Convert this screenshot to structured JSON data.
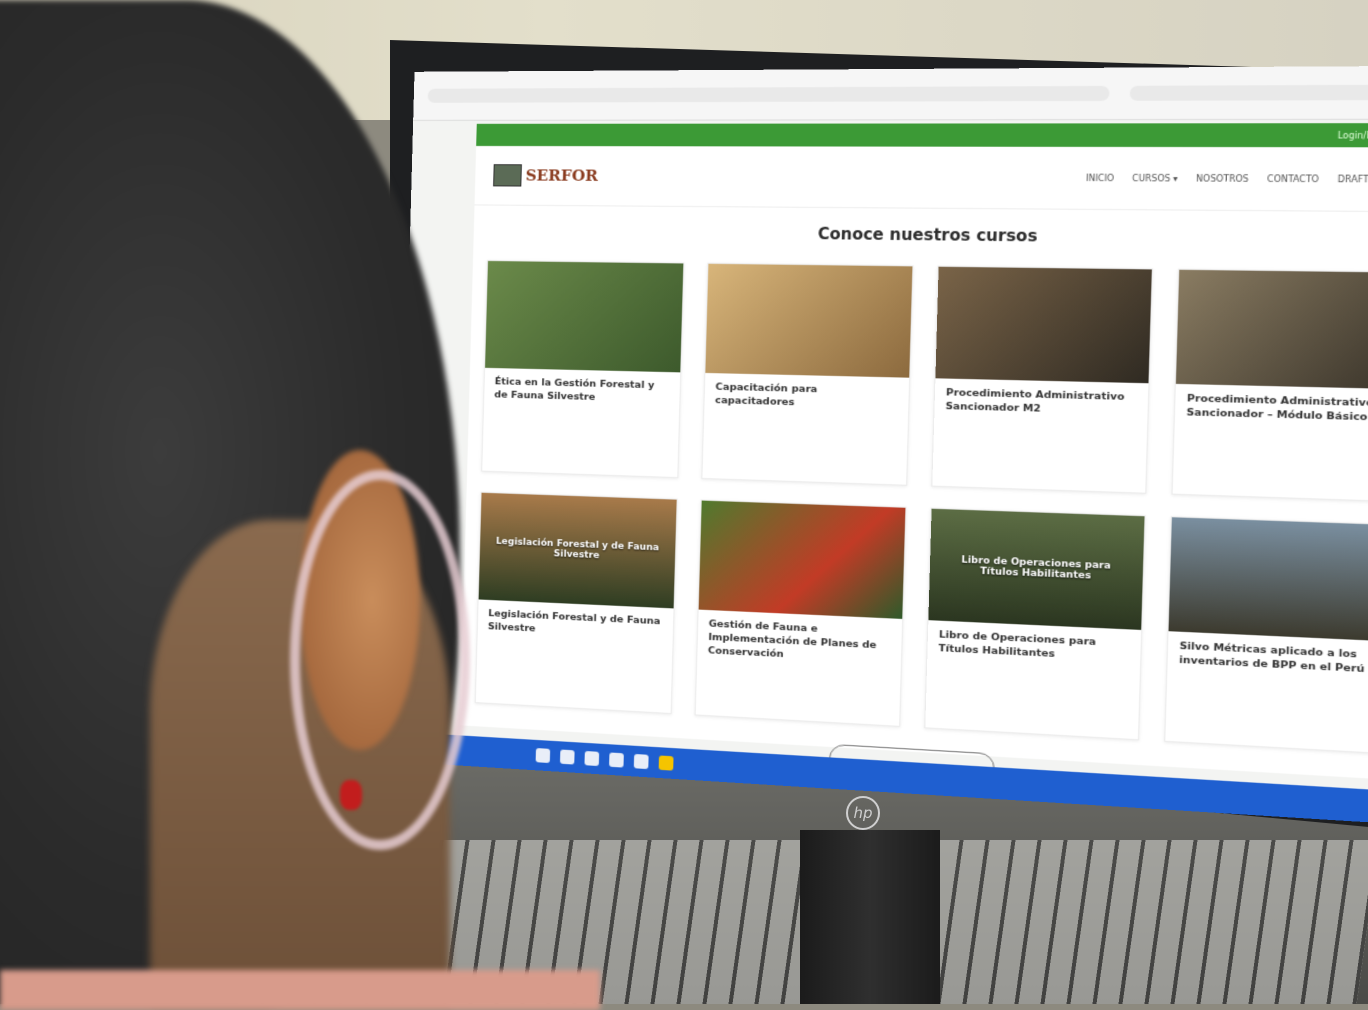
{
  "website": {
    "top_strip_link": "Login/Registro",
    "logo_line1": "SERFOR",
    "logo_line2": "",
    "nav": [
      {
        "label": "INICIO"
      },
      {
        "label": "CURSOS ▾"
      },
      {
        "label": "NOSOTROS"
      },
      {
        "label": "CONTACTO"
      },
      {
        "label": "DRAFT"
      }
    ],
    "section_title": "Conoce nuestros cursos",
    "courses": [
      {
        "title": "Ética en la Gestión Forestal y de Fauna Silvestre",
        "meta": "",
        "thumb_text": "",
        "thumb_color": "#4f6b3c"
      },
      {
        "title": "Capacitación para capacitadores",
        "meta": "",
        "thumb_text": "",
        "thumb_color": "#b98a4a"
      },
      {
        "title": "Procedimiento Administrativo Sancionador M2",
        "meta": "",
        "thumb_text": "",
        "thumb_color": "#5b4b34"
      },
      {
        "title": "Procedimiento Administrativo Sancionador – Módulo Básico",
        "meta": "",
        "thumb_text": "",
        "thumb_color": "#6d6048"
      },
      {
        "title": "Legislación Forestal y de Fauna Silvestre",
        "meta": "",
        "thumb_text": "Legislación Forestal y de Fauna Silvestre",
        "thumb_color": "#3f4f2f"
      },
      {
        "title": "Gestión de Fauna e Implementación de Planes de Conservación",
        "meta": "",
        "thumb_text": "",
        "thumb_color": "#5d7d3a"
      },
      {
        "title": "Libro de Operaciones para Títulos Habilitantes",
        "meta": "",
        "thumb_text": "Libro de Operaciones para Títulos Habilitantes",
        "thumb_color": "#3e5632"
      },
      {
        "title": "Silvo Métricas aplicado a los inventarios de BPP en el Perú",
        "meta": "",
        "thumb_text": "",
        "thumb_color": "#6a5e48"
      }
    ],
    "more_button": ""
  },
  "monitor_brand": "hp"
}
